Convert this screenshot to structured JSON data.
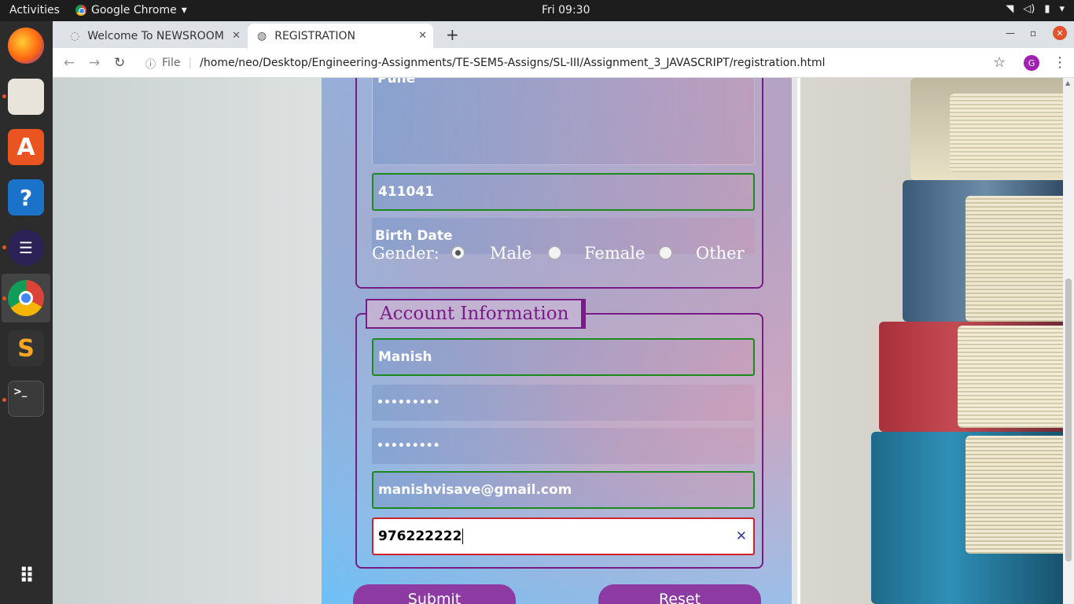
{
  "topbar": {
    "activities": "Activities",
    "app_name": "Google Chrome",
    "clock": "Fri 09:30"
  },
  "tabs": [
    {
      "title": "Welcome To NEWSROOM"
    },
    {
      "title": "REGISTRATION"
    }
  ],
  "address": {
    "scheme": "File",
    "url": "/home/neo/Desktop/Engineering-Assignments/TE-SEM5-Assigns/SL-III/Assignment_3_JAVASCRIPT/registration.html",
    "profile_initial": "G"
  },
  "form": {
    "address_value": "Pune",
    "pincode_value": "411041",
    "birth_date_placeholder": "Birth Date",
    "gender_label": "Gender:",
    "gender_options": [
      "Male",
      "Female",
      "Other"
    ],
    "gender_selected": "Male",
    "account_legend": "Account Information",
    "username_value": "Manish",
    "password_value": "•••••••••",
    "confirm_password_value": "•••••••••",
    "email_value": "manishvisave@gmail.com",
    "phone_value": "976222222",
    "submit_label": "Submit",
    "reset_label": "Reset"
  },
  "colors": {
    "accent": "#7a1a86",
    "valid_border": "#1d8a1d",
    "invalid_border": "#d0202a",
    "button": "#8e3aa3"
  }
}
